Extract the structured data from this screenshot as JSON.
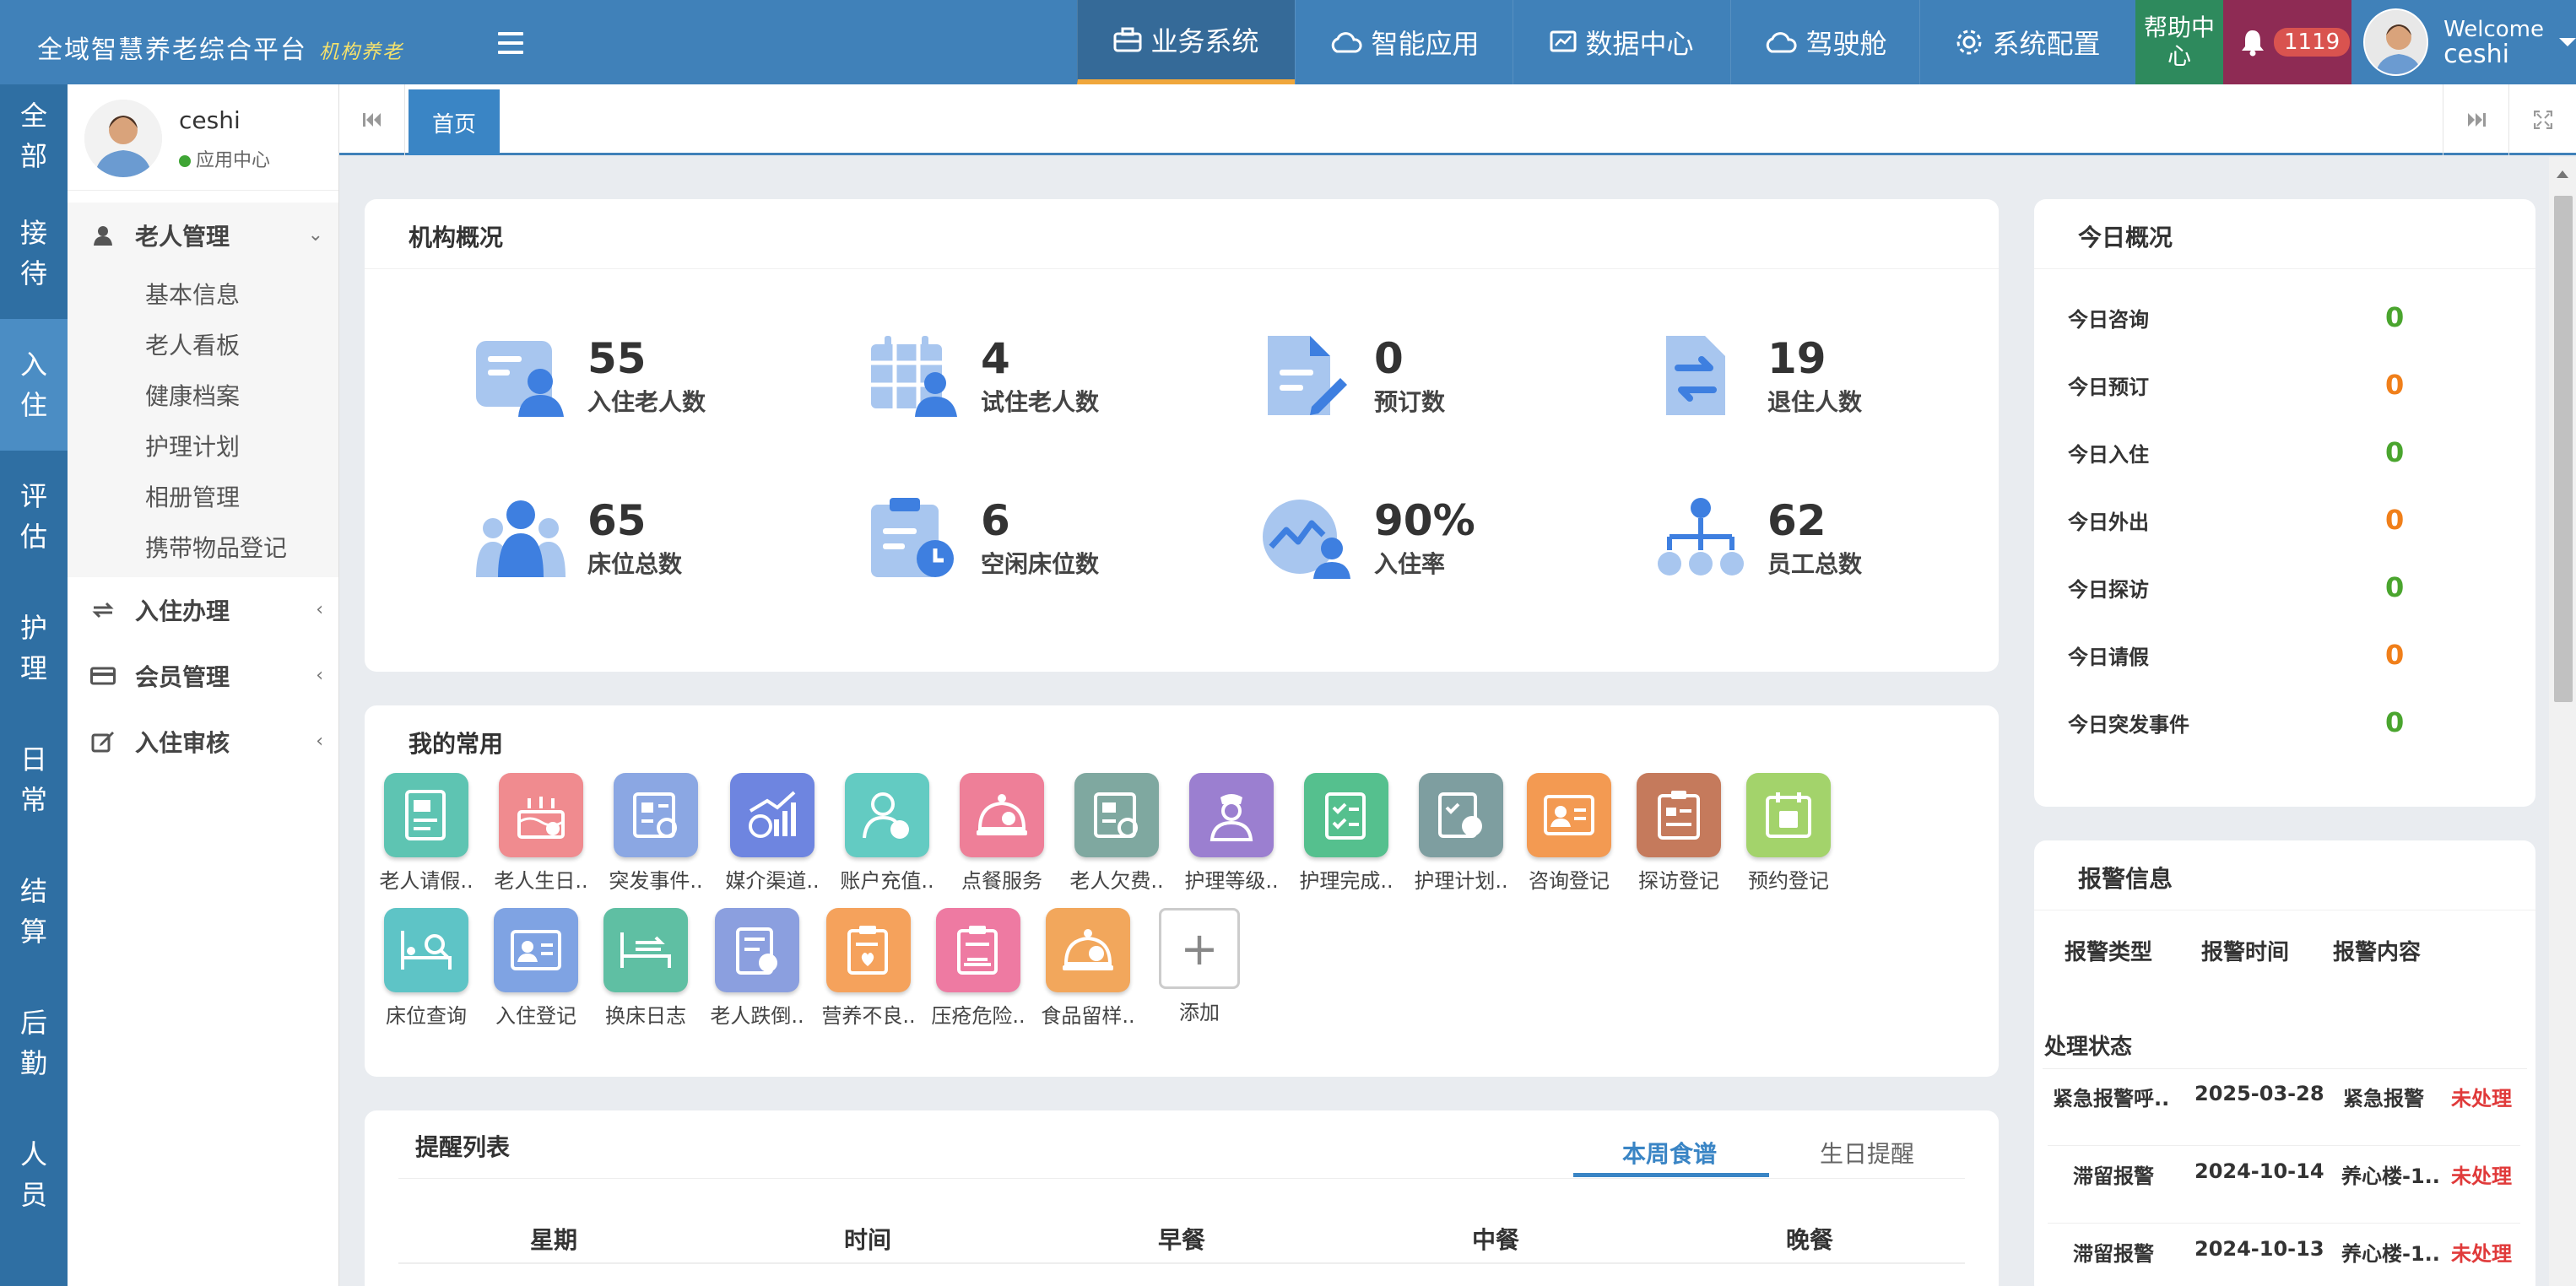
{
  "topbar": {
    "brand": "全域智慧养老综合平台",
    "brand_sub": "机构养老",
    "nav": [
      "业务系统",
      "智能应用",
      "数据中心",
      "驾驶舱",
      "系统配置"
    ],
    "help": "帮助中心",
    "notif_count": "1119",
    "welcome": "Welcome",
    "username": "ceshi"
  },
  "leftnav": [
    "全部",
    "接待",
    "入住",
    "评估",
    "护理",
    "日常",
    "结算",
    "后勤",
    "人员"
  ],
  "side": {
    "name": "ceshi",
    "status": "应用中心",
    "group_open": "老人管理",
    "subitems": [
      "基本信息",
      "老人看板",
      "健康档案",
      "护理计划",
      "相册管理",
      "携带物品登记"
    ],
    "groups": [
      "入住办理",
      "会员管理",
      "入住审核"
    ]
  },
  "tabs": {
    "home": "首页"
  },
  "overview": {
    "title": "机构概况",
    "stats": [
      {
        "value": "55",
        "label": "入住老人数"
      },
      {
        "value": "4",
        "label": "试住老人数"
      },
      {
        "value": "0",
        "label": "预订数"
      },
      {
        "value": "19",
        "label": "退住人数"
      },
      {
        "value": "65",
        "label": "床位总数"
      },
      {
        "value": "6",
        "label": "空闲床位数"
      },
      {
        "value": "90%",
        "label": "入住率"
      },
      {
        "value": "62",
        "label": "员工总数"
      }
    ]
  },
  "favorites": {
    "title": "我的常用",
    "items": [
      "老人请假..",
      "老人生日..",
      "突发事件..",
      "媒介渠道..",
      "账户充值..",
      "点餐服务",
      "老人欠费..",
      "护理等级..",
      "护理完成..",
      "护理计划..",
      "咨询登记",
      "探访登记",
      "预约登记",
      "床位查询",
      "入住登记",
      "换床日志",
      "老人跌倒..",
      "营养不良..",
      "压疮危险..",
      "食品留样.."
    ],
    "add": "添加"
  },
  "reminders": {
    "title": "提醒列表",
    "tabs": [
      "本周食谱",
      "生日提醒"
    ],
    "columns": [
      "星期",
      "时间",
      "早餐",
      "中餐",
      "晚餐"
    ]
  },
  "today": {
    "title": "今日概况",
    "rows": [
      {
        "label": "今日咨询",
        "value": "0"
      },
      {
        "label": "今日预订",
        "value": "0"
      },
      {
        "label": "今日入住",
        "value": "0"
      },
      {
        "label": "今日外出",
        "value": "0"
      },
      {
        "label": "今日探访",
        "value": "0"
      },
      {
        "label": "今日请假",
        "value": "0"
      },
      {
        "label": "今日突发事件",
        "value": "0"
      }
    ],
    "colors": [
      "#4aa52e",
      "#f07f1a"
    ]
  },
  "alarms": {
    "title": "报警信息",
    "columns": [
      "报警类型",
      "报警时间",
      "报警内容",
      "处理状态"
    ],
    "rows": [
      {
        "type": "紧急报警呼..",
        "time": "2025-03-28",
        "content": "紧急报警",
        "status": "未处理"
      },
      {
        "type": "滞留报警",
        "time": "2024-10-14",
        "content": "养心楼-1..",
        "status": "未处理"
      },
      {
        "type": "滞留报警",
        "time": "2024-10-13",
        "content": "养心楼-1..",
        "status": "未处理"
      }
    ]
  }
}
